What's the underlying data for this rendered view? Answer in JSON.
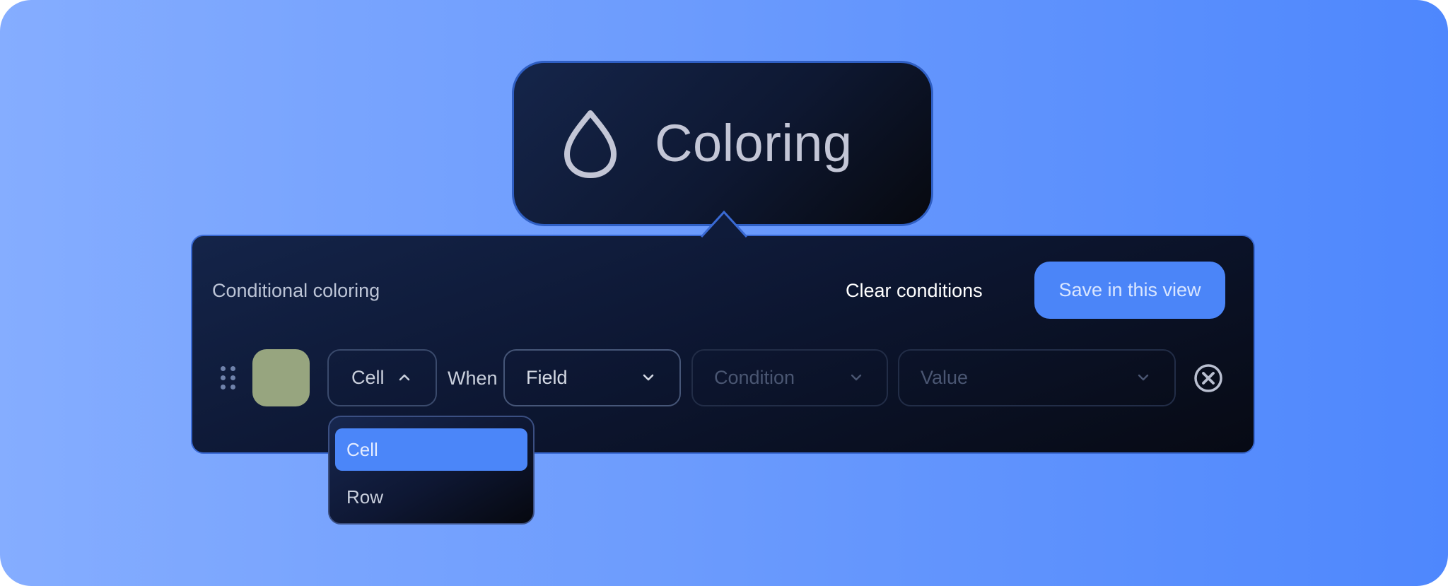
{
  "tooltip": {
    "title": "Coloring",
    "icon": "drop-icon"
  },
  "panel": {
    "title": "Conditional coloring",
    "clear_label": "Clear conditions",
    "save_label": "Save in this view"
  },
  "rule": {
    "swatch_color": "#97a57f",
    "target_value": "Cell",
    "when_label": "When",
    "field_value": "Field",
    "condition_placeholder": "Condition",
    "value_placeholder": "Value"
  },
  "dropdown": {
    "options": [
      {
        "label": "Cell",
        "selected": true
      },
      {
        "label": "Row",
        "selected": false
      }
    ]
  },
  "colors": {
    "accent": "#4b85f8",
    "panel_bg": "#0d1733",
    "background_start": "#85adff",
    "background_end": "#4e87fd"
  }
}
